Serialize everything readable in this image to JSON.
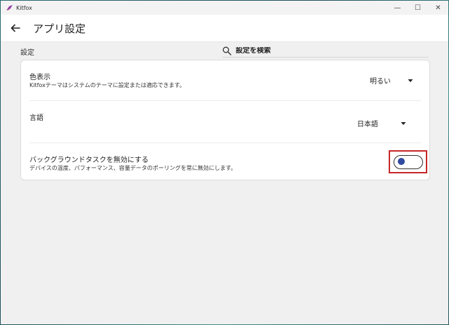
{
  "window": {
    "app_name": "Kitfox",
    "controls": {
      "minimize": "—",
      "maximize": "☐",
      "close": "✕"
    }
  },
  "header": {
    "title": "アプリ設定"
  },
  "subbar": {
    "section_label": "設定",
    "search": {
      "placeholder": "設定を検索",
      "value": ""
    }
  },
  "settings": {
    "color": {
      "title": "色表示",
      "description": "Kitfoxテーマはシステムのテーマに設定または適応できます。",
      "selected": "明るい"
    },
    "language": {
      "title": "言語",
      "selected": "日本語"
    },
    "background_tasks": {
      "title": "バックグラウンドタスクを無効にする",
      "description": "デバイスの温度、パフォーマンス、容量データのポーリングを常に無効にします。",
      "toggle_on": false
    }
  },
  "colors": {
    "toggle_knob": "#2f4a9e",
    "highlight_box": "#c62828",
    "logo": "#8e3fa0"
  },
  "icons": [
    "kitfox-logo-icon",
    "back-arrow-icon",
    "search-icon",
    "chevron-down-icon"
  ]
}
